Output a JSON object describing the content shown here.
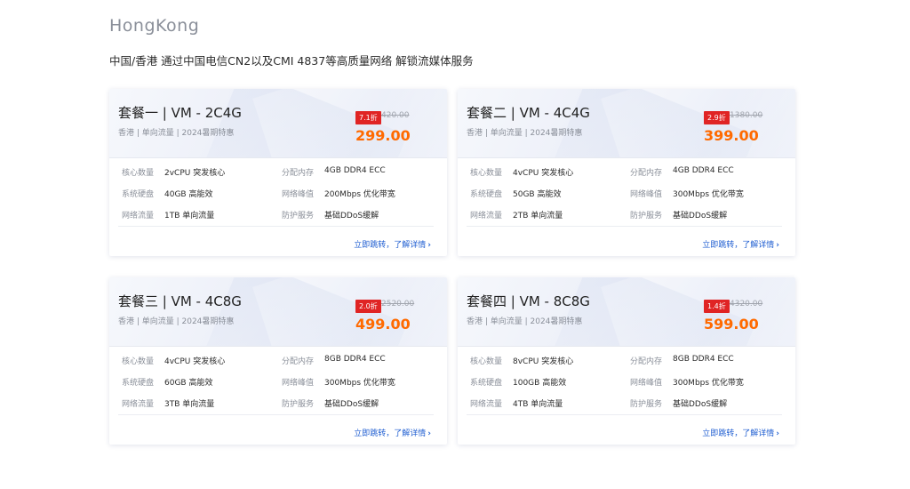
{
  "region": {
    "title": "HongKong",
    "description": "中国/香港 通过中国电信CN2以及CMI 4837等高质量网络 解锁流媒体服务"
  },
  "cards": [
    {
      "name": "套餐一 | VM - 2C4G",
      "subtitle": "香港 | 单向流量 | 2024暑期特惠",
      "discount": "7.1折",
      "original_price": "420.00",
      "price": "299.00",
      "specs": [
        {
          "label": "核心数量",
          "value": "2vCPU 突发核心"
        },
        {
          "label": "分配内存",
          "value": "4GB DDR4 ECC"
        },
        {
          "label": "系统硬盘",
          "value": "40GB 高能效"
        },
        {
          "label": "网络峰值",
          "value": "200Mbps 优化带宽"
        },
        {
          "label": "网络流量",
          "value": "1TB 单向流量"
        },
        {
          "label": "防护服务",
          "value": "基础DDoS缓解"
        }
      ],
      "link": "立即跳转，了解详情"
    },
    {
      "name": "套餐二 | VM - 4C4G",
      "subtitle": "香港 | 单向流量 | 2024暑期特惠",
      "discount": "2.9折",
      "original_price": "1380.00",
      "price": "399.00",
      "specs": [
        {
          "label": "核心数量",
          "value": "4vCPU 突发核心"
        },
        {
          "label": "分配内存",
          "value": "4GB DDR4 ECC"
        },
        {
          "label": "系统硬盘",
          "value": "50GB 高能效"
        },
        {
          "label": "网络峰值",
          "value": "300Mbps 优化带宽"
        },
        {
          "label": "网络流量",
          "value": "2TB 单向流量"
        },
        {
          "label": "防护服务",
          "value": "基础DDoS缓解"
        }
      ],
      "link": "立即跳转，了解详情"
    },
    {
      "name": "套餐三 | VM - 4C8G",
      "subtitle": "香港 | 单向流量 | 2024暑期特惠",
      "discount": "2.0折",
      "original_price": "2520.00",
      "price": "499.00",
      "specs": [
        {
          "label": "核心数量",
          "value": "4vCPU 突发核心"
        },
        {
          "label": "分配内存",
          "value": "8GB DDR4 ECC"
        },
        {
          "label": "系统硬盘",
          "value": "60GB 高能效"
        },
        {
          "label": "网络峰值",
          "value": "300Mbps 优化带宽"
        },
        {
          "label": "网络流量",
          "value": "3TB 单向流量"
        },
        {
          "label": "防护服务",
          "value": "基础DDoS缓解"
        }
      ],
      "link": "立即跳转，了解详情"
    },
    {
      "name": "套餐四 | VM - 8C8G",
      "subtitle": "香港 | 单向流量 | 2024暑期特惠",
      "discount": "1.4折",
      "original_price": "4320.00",
      "price": "599.00",
      "specs": [
        {
          "label": "核心数量",
          "value": "8vCPU 突发核心"
        },
        {
          "label": "分配内存",
          "value": "8GB DDR4 ECC"
        },
        {
          "label": "系统硬盘",
          "value": "100GB 高能效"
        },
        {
          "label": "网络峰值",
          "value": "300Mbps 优化带宽"
        },
        {
          "label": "网络流量",
          "value": "4TB 单向流量"
        },
        {
          "label": "防护服务",
          "value": "基础DDoS缓解"
        }
      ],
      "link": "立即跳转，了解详情"
    }
  ],
  "icons": {
    "link_chevron": "chevron-right-icon"
  },
  "colors": {
    "price": "#ff6a00",
    "badge": "#e02424",
    "link": "#1f5ed1"
  }
}
